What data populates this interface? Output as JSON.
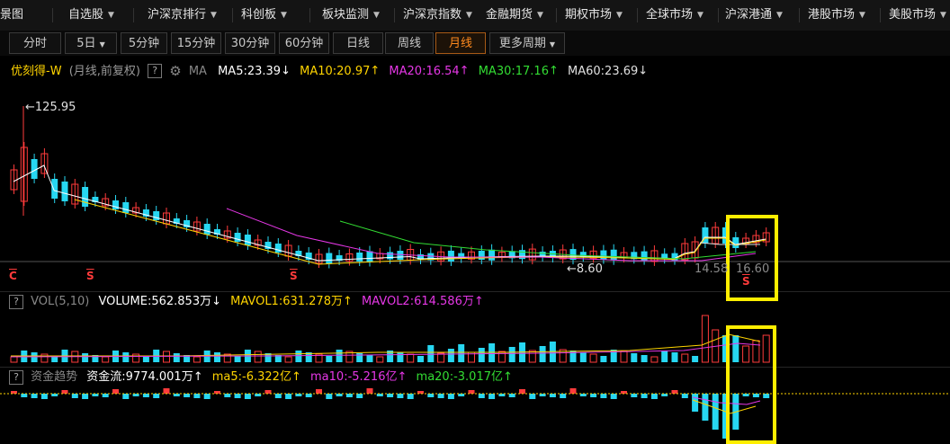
{
  "nav": {
    "items": [
      {
        "label": "景图",
        "caret": false
      },
      {
        "label": "自选股",
        "caret": true
      },
      {
        "label": "沪深京排行",
        "caret": true
      },
      {
        "label": "科创板",
        "caret": true
      },
      {
        "label": "板块监测",
        "caret": true
      },
      {
        "label": "沪深京指数",
        "caret": true
      },
      {
        "label": "金融期货",
        "caret": true
      },
      {
        "label": "期权市场",
        "caret": true
      },
      {
        "label": "全球市场",
        "caret": true
      },
      {
        "label": "沪深港通",
        "caret": true
      },
      {
        "label": "港股市场",
        "caret": true
      },
      {
        "label": "美股市场",
        "caret": true
      }
    ]
  },
  "periods": {
    "tabs": [
      {
        "label": "分时"
      },
      {
        "label": "5日",
        "caret": true
      },
      {
        "label": "5分钟"
      },
      {
        "label": "15分钟"
      },
      {
        "label": "30分钟"
      },
      {
        "label": "60分钟"
      },
      {
        "label": "日线"
      },
      {
        "label": "周线"
      },
      {
        "label": "月线",
        "active": true
      },
      {
        "label": "更多周期",
        "caret": true
      }
    ]
  },
  "main": {
    "stock_name": "优刻得-W",
    "mode": "(月线,前复权)",
    "help": "?",
    "ma_label": "MA",
    "ma5": "MA5:23.39",
    "ma10": "MA10:20.97",
    "ma20": "MA20:16.54",
    "ma30": "MA30:17.16",
    "ma60": "MA60:23.69",
    "high_label": "125.95",
    "low_label": "8.60",
    "price_left": "14.58",
    "price_right": "16.60",
    "markers": [
      "C",
      "S",
      "S",
      "S"
    ]
  },
  "volume": {
    "title": "VOL(5,10)",
    "volume": "VOLUME:562.853万",
    "mavol1": "MAVOL1:631.278万",
    "mavol2": "MAVOL2:614.586万"
  },
  "fund": {
    "title": "资金趋势",
    "flow": "资金流:9774.001万",
    "ma5": "ma5:-6.322亿",
    "ma10": "ma10:-5.216亿",
    "ma20": "ma20:-3.017亿"
  },
  "colors": {
    "up": "#ff3b3b",
    "down": "#27d7f2",
    "ma5": "#ffffff",
    "ma10": "#ffd400",
    "ma20": "#e637e6",
    "ma30": "#33dd33",
    "ma60": "#e0e0e0",
    "highlight": "#ffee00",
    "active_tab": "#ff8a1e"
  },
  "icons": [
    "settings-gear-icon",
    "dropdown-caret-icon",
    "help-icon",
    "arrow-up-icon",
    "arrow-down-icon"
  ]
}
